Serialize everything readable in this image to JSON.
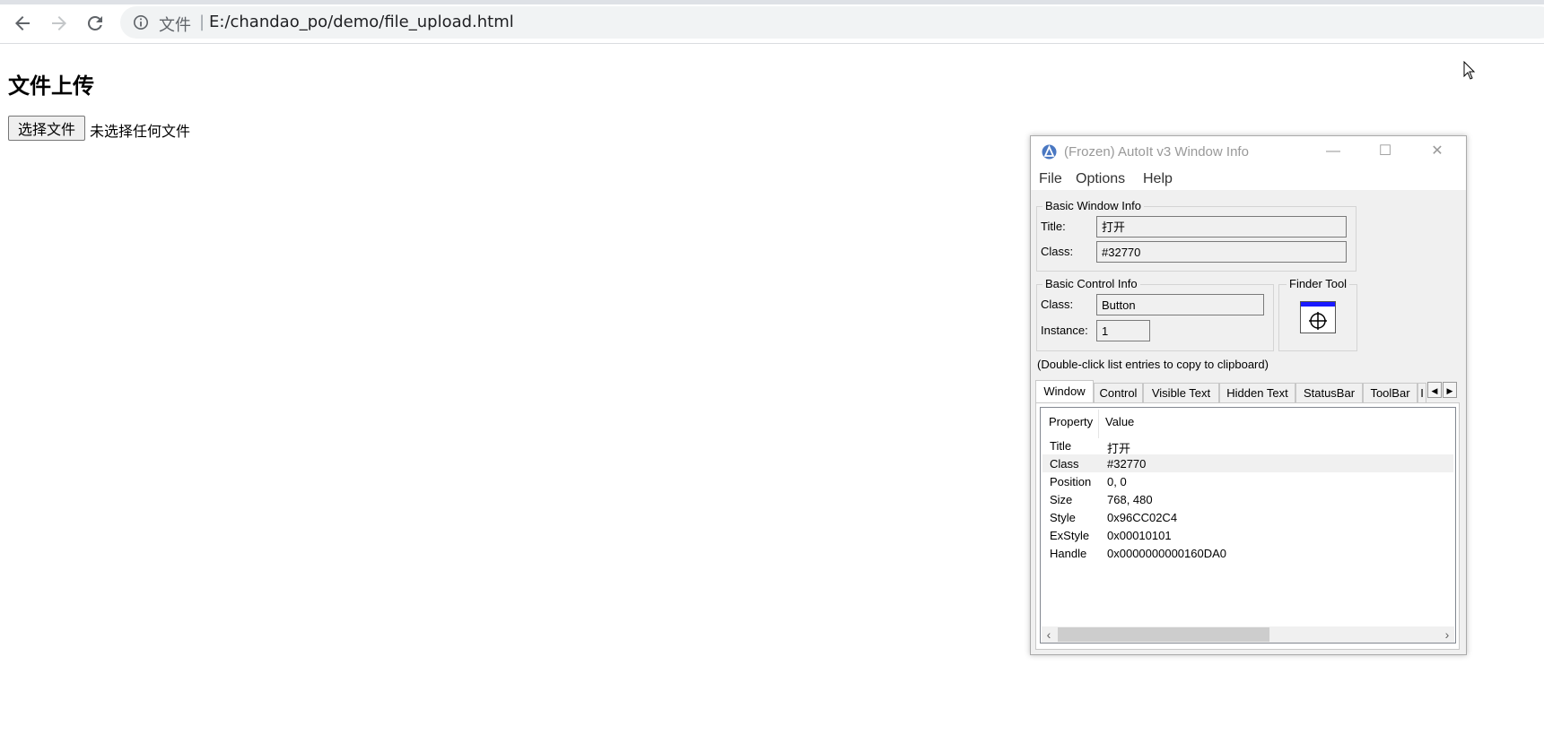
{
  "browser": {
    "scheme_label": "文件",
    "separator": "|",
    "url": "E:/chandao_po/demo/file_upload.html"
  },
  "page": {
    "heading": "文件上传",
    "file_button_label": "选择文件",
    "file_status": "未选择任何文件"
  },
  "autoit": {
    "title": "(Frozen) AutoIt v3 Window Info",
    "window_buttons": {
      "minimize": "—",
      "maximize": "☐",
      "close": "✕"
    },
    "menu": [
      "File",
      "Options",
      "Help"
    ],
    "basic_window_info": {
      "label": "Basic Window Info",
      "title_label": "Title:",
      "title_value": "打开",
      "class_label": "Class:",
      "class_value": "#32770"
    },
    "basic_control_info": {
      "label": "Basic Control Info",
      "class_label": "Class:",
      "class_value": "Button",
      "instance_label": "Instance:",
      "instance_value": "1"
    },
    "finder_tool_label": "Finder Tool",
    "hint": "(Double-click list entries to copy to clipboard)",
    "tabs": [
      "Window",
      "Control",
      "Visible Text",
      "Hidden Text",
      "StatusBar",
      "ToolBar",
      "I"
    ],
    "active_tab": "Window",
    "columns": [
      "Property",
      "Value"
    ],
    "rows": [
      {
        "property": "Title",
        "value": "打开"
      },
      {
        "property": "Class",
        "value": "#32770"
      },
      {
        "property": "Position",
        "value": "0, 0"
      },
      {
        "property": "Size",
        "value": "768, 480"
      },
      {
        "property": "Style",
        "value": "0x96CC02C4"
      },
      {
        "property": "ExStyle",
        "value": "0x00010101"
      },
      {
        "property": "Handle",
        "value": "0x0000000000160DA0"
      }
    ],
    "selected_row": "Class"
  },
  "colors": {
    "omnibox_bg": "#f1f3f4",
    "finder_bar": "#1a1aff",
    "app_icon": "#4a78c2"
  }
}
